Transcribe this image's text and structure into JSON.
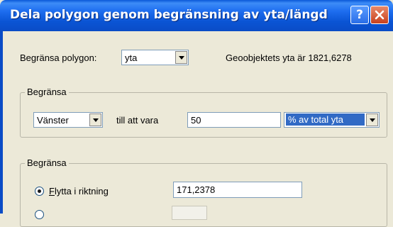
{
  "window": {
    "title": "Dela polygon genom begränsning av yta/längd",
    "help_button": "?",
    "close_button": "×"
  },
  "top": {
    "limit_label": "Begränsa polygon:",
    "limit_value": "yta",
    "area_info": "Geoobjektets yta är 1821,6278"
  },
  "group1": {
    "title": "Begränsa",
    "side_value": "Vänster",
    "until_label": "till att vara",
    "amount_value": "50",
    "unit_value": "% av total yta"
  },
  "group2": {
    "title": "Begränsa",
    "radio1_accel": "F",
    "radio1_rest": "lytta i riktning",
    "radio1_selected": true,
    "direction_value": "171,2378"
  }
}
